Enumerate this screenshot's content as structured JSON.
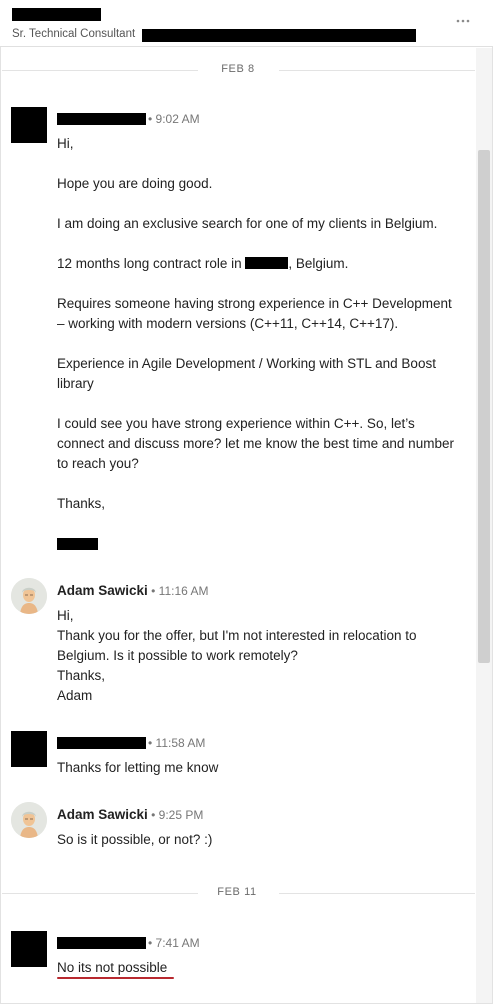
{
  "header": {
    "subtitle": "Sr. Technical Consultant",
    "more_icon": "ellipsis-icon"
  },
  "dividers": [
    "FEB 8",
    "FEB 11"
  ],
  "messages": [
    {
      "time": "9:02 AM",
      "lines": [
        "Hi,",
        "",
        "Hope you are doing good.",
        "",
        "I am doing an exclusive search for one of my clients in Belgium.",
        "",
        "12 months long contract role in",
        "",
        "Requires someone having strong experience in C++ Development",
        "– working with modern versions (C++11, C++14, C++17).",
        "",
        "Experience in Agile Development / Working with STL and Boost",
        "library",
        "",
        "I could see you have strong experience within C++. So, let’s",
        "connect and discuss more? let me know the best time and number",
        "to reach you?",
        "",
        "Thanks,"
      ],
      "location_suffix": ", Belgium."
    },
    {
      "sender": "Adam Sawicki",
      "time": "11:16 AM",
      "lines": [
        "Hi,",
        "Thank you for the offer, but I'm not interested in relocation to",
        "Belgium. Is it possible to work remotely?",
        "Thanks,",
        "Adam"
      ]
    },
    {
      "time": "11:58 AM",
      "lines": [
        "Thanks for letting me know"
      ]
    },
    {
      "sender": "Adam Sawicki",
      "time": "9:25 PM",
      "lines": [
        "So is it possible, or not? :)"
      ]
    },
    {
      "time": "7:41 AM",
      "lines": [
        "No its not possible"
      ]
    }
  ],
  "colors": {
    "redaction": "#000000",
    "underline": "#b8292f",
    "divider": "#e3e3e3"
  }
}
